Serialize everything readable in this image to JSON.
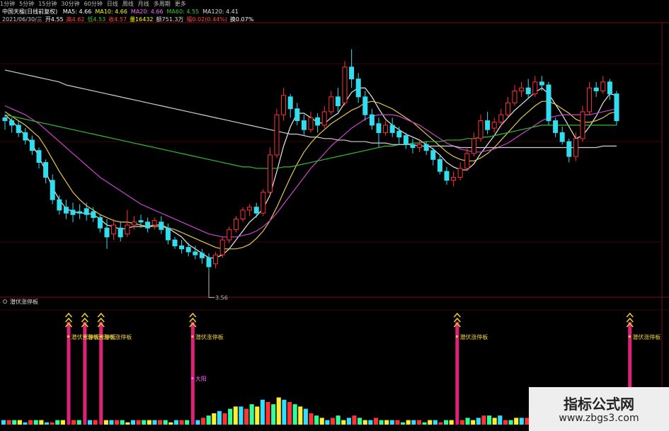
{
  "toolbar": {
    "tabs": [
      "1分钟",
      "5分钟",
      "15分钟",
      "30分钟",
      "60分钟",
      "日线",
      "周线",
      "月线",
      "多周期",
      "更多"
    ]
  },
  "header": {
    "stock": "中国天楹(日线前复权)",
    "ma_items": [
      {
        "label": "MA5: 4.66",
        "color": "#ffffff"
      },
      {
        "label": "MA10: 4.66",
        "color": "#ffff00"
      },
      {
        "label": "MA20: 4.66",
        "color": "#ff66ff"
      },
      {
        "label": "MA60: 4.55",
        "color": "#33cc33"
      },
      {
        "label": "MA120: 4.41",
        "color": "#dddddd"
      }
    ],
    "quote": [
      {
        "text": "2021/06/30/三",
        "color": "#cccccc"
      },
      {
        "text": "开4.55",
        "color": "#ffffff"
      },
      {
        "text": "高4.62",
        "color": "#ff4444"
      },
      {
        "text": "低4.53",
        "color": "#33cc33"
      },
      {
        "text": "收4.57",
        "color": "#ff4444"
      },
      {
        "text": "量16432",
        "color": "#ffff00"
      },
      {
        "text": "额751.3万",
        "color": "#dddddd"
      },
      {
        "text": "幅0.02(0.44%)",
        "color": "#ff4444"
      },
      {
        "text": "换0.07%",
        "color": "#ffffff"
      }
    ]
  },
  "chart_data": [
    {
      "type": "candlestick",
      "title": "中国天楹(日线前复权)",
      "ylim": [
        3.5,
        5.2
      ],
      "min_label": "3.56",
      "candles": [
        [
          4.6,
          4.58,
          4.62,
          4.52
        ],
        [
          4.58,
          4.55,
          4.6,
          4.5
        ],
        [
          4.55,
          4.5,
          4.58,
          4.47
        ],
        [
          4.5,
          4.45,
          4.53,
          4.42
        ],
        [
          4.45,
          4.38,
          4.48,
          4.35
        ],
        [
          4.38,
          4.3,
          4.4,
          4.26
        ],
        [
          4.3,
          4.2,
          4.32,
          4.16
        ],
        [
          4.18,
          4.05,
          4.22,
          4.02
        ],
        [
          4.05,
          3.98,
          4.08,
          3.95
        ],
        [
          4.0,
          3.96,
          4.05,
          3.92
        ],
        [
          3.98,
          3.95,
          4.03,
          3.9
        ],
        [
          3.97,
          3.96,
          4.02,
          3.92
        ],
        [
          3.99,
          3.95,
          4.03,
          3.91
        ],
        [
          3.97,
          3.93,
          4.0,
          3.9
        ],
        [
          3.93,
          3.86,
          3.95,
          3.83
        ],
        [
          3.86,
          3.8,
          3.92,
          3.72
        ],
        [
          3.82,
          3.88,
          3.92,
          3.78
        ],
        [
          3.86,
          3.8,
          3.9,
          3.77
        ],
        [
          3.82,
          3.88,
          3.98,
          3.8
        ],
        [
          3.88,
          3.9,
          3.94,
          3.85
        ],
        [
          3.91,
          3.9,
          3.95,
          3.86
        ],
        [
          3.9,
          3.86,
          3.93,
          3.83
        ],
        [
          3.88,
          3.91,
          3.93,
          3.85
        ],
        [
          3.9,
          3.85,
          3.94,
          3.82
        ],
        [
          3.86,
          3.78,
          3.89,
          3.75
        ],
        [
          3.78,
          3.74,
          3.8,
          3.72
        ],
        [
          3.74,
          3.72,
          3.78,
          3.69
        ],
        [
          3.73,
          3.7,
          3.76,
          3.67
        ],
        [
          3.7,
          3.68,
          3.74,
          3.65
        ],
        [
          3.69,
          3.66,
          3.72,
          3.62
        ],
        [
          3.66,
          3.6,
          3.69,
          3.56
        ],
        [
          3.62,
          3.68,
          3.7,
          3.59
        ],
        [
          3.68,
          3.78,
          3.8,
          3.66
        ],
        [
          3.78,
          3.85,
          3.87,
          3.76
        ],
        [
          3.85,
          3.92,
          3.94,
          3.83
        ],
        [
          3.92,
          3.98,
          4.0,
          3.9
        ],
        [
          3.98,
          4.0,
          4.02,
          3.94
        ],
        [
          4.0,
          3.96,
          4.03,
          3.93
        ],
        [
          3.96,
          4.1,
          4.12,
          3.94
        ],
        [
          4.1,
          4.35,
          4.4,
          4.08
        ],
        [
          4.35,
          4.62,
          4.66,
          4.33
        ],
        [
          4.62,
          4.75,
          4.8,
          4.58
        ],
        [
          4.74,
          4.66,
          4.76,
          4.6
        ],
        [
          4.66,
          4.58,
          4.7,
          4.55
        ],
        [
          4.58,
          4.52,
          4.62,
          4.48
        ],
        [
          4.52,
          4.6,
          4.64,
          4.5
        ],
        [
          4.6,
          4.55,
          4.63,
          4.5
        ],
        [
          4.55,
          4.64,
          4.68,
          4.53
        ],
        [
          4.64,
          4.74,
          4.78,
          4.62
        ],
        [
          4.74,
          4.68,
          4.8,
          4.64
        ],
        [
          4.7,
          4.94,
          4.98,
          4.68
        ],
        [
          4.94,
          4.86,
          5.06,
          4.8
        ],
        [
          4.86,
          4.74,
          4.9,
          4.7
        ],
        [
          4.74,
          4.62,
          4.78,
          4.58
        ],
        [
          4.62,
          4.55,
          4.66,
          4.52
        ],
        [
          4.56,
          4.5,
          4.6,
          4.4
        ],
        [
          4.5,
          4.55,
          4.58,
          4.48
        ],
        [
          4.55,
          4.5,
          4.6,
          4.47
        ],
        [
          4.51,
          4.47,
          4.54,
          4.42
        ],
        [
          4.48,
          4.42,
          4.5,
          4.39
        ],
        [
          4.42,
          4.4,
          4.46,
          4.36
        ],
        [
          4.4,
          4.42,
          4.45,
          4.37
        ],
        [
          4.42,
          4.38,
          4.44,
          4.35
        ],
        [
          4.38,
          4.32,
          4.4,
          4.28
        ],
        [
          4.32,
          4.24,
          4.35,
          4.22
        ],
        [
          4.24,
          4.18,
          4.27,
          4.15
        ],
        [
          4.18,
          4.2,
          4.24,
          4.14
        ],
        [
          4.2,
          4.26,
          4.3,
          4.18
        ],
        [
          4.26,
          4.36,
          4.4,
          4.24
        ],
        [
          4.36,
          4.46,
          4.5,
          4.34
        ],
        [
          4.46,
          4.58,
          4.62,
          4.44
        ],
        [
          4.58,
          4.52,
          4.64,
          4.49
        ],
        [
          4.53,
          4.57,
          4.6,
          4.5
        ],
        [
          4.57,
          4.62,
          4.66,
          4.54
        ],
        [
          4.62,
          4.7,
          4.74,
          4.6
        ],
        [
          4.7,
          4.78,
          4.82,
          4.68
        ],
        [
          4.78,
          4.8,
          4.84,
          4.74
        ],
        [
          4.8,
          4.76,
          4.86,
          4.73
        ],
        [
          4.76,
          4.84,
          4.88,
          4.74
        ],
        [
          4.84,
          4.82,
          4.88,
          4.78
        ],
        [
          4.82,
          4.58,
          4.84,
          4.55
        ],
        [
          4.58,
          4.5,
          4.6,
          4.47
        ],
        [
          4.5,
          4.44,
          4.54,
          4.42
        ],
        [
          4.44,
          4.34,
          4.46,
          4.3
        ],
        [
          4.34,
          4.46,
          4.5,
          4.31
        ],
        [
          4.46,
          4.64,
          4.68,
          4.44
        ],
        [
          4.64,
          4.8,
          4.84,
          4.62
        ],
        [
          4.8,
          4.78,
          4.84,
          4.74
        ],
        [
          4.78,
          4.84,
          4.88,
          4.76
        ],
        [
          4.84,
          4.76,
          4.86,
          4.72
        ],
        [
          4.76,
          4.58,
          4.78,
          4.55
        ]
      ],
      "ma_lines": [
        {
          "name": "MA5",
          "color": "#e8e8e8",
          "values": [
            4.62,
            4.58,
            4.53,
            4.48,
            4.42,
            4.34,
            4.24,
            4.13,
            4.05,
            3.99,
            3.97,
            3.96,
            3.96,
            3.95,
            3.92,
            3.88,
            3.87,
            3.85,
            3.86,
            3.87,
            3.87,
            3.87,
            3.88,
            3.88,
            3.86,
            3.83,
            3.8,
            3.75,
            3.72,
            3.69,
            3.66,
            3.66,
            3.68,
            3.72,
            3.78,
            3.84,
            3.9,
            3.94,
            3.99,
            4.08,
            4.24,
            4.41,
            4.54,
            4.63,
            4.63,
            4.6,
            4.57,
            4.56,
            4.6,
            4.63,
            4.7,
            4.77,
            4.8,
            4.8,
            4.74,
            4.66,
            4.59,
            4.55,
            4.52,
            4.49,
            4.47,
            4.45,
            4.42,
            4.39,
            4.35,
            4.3,
            4.27,
            4.25,
            4.25,
            4.29,
            4.36,
            4.42,
            4.48,
            4.55,
            4.6,
            4.65,
            4.69,
            4.73,
            4.77,
            4.8,
            4.76,
            4.69,
            4.62,
            4.54,
            4.46,
            4.48,
            4.54,
            4.61,
            4.7,
            4.76,
            4.75
          ]
        },
        {
          "name": "MA10",
          "color": "#e6c84a",
          "values": [
            4.64,
            4.61,
            4.58,
            4.55,
            4.51,
            4.47,
            4.4,
            4.32,
            4.24,
            4.17,
            4.1,
            4.05,
            4.01,
            3.98,
            3.95,
            3.93,
            3.91,
            3.9,
            3.9,
            3.89,
            3.88,
            3.87,
            3.87,
            3.87,
            3.86,
            3.85,
            3.83,
            3.81,
            3.79,
            3.77,
            3.75,
            3.73,
            3.72,
            3.72,
            3.72,
            3.73,
            3.75,
            3.79,
            3.84,
            3.91,
            4.0,
            4.1,
            4.2,
            4.29,
            4.37,
            4.43,
            4.48,
            4.52,
            4.56,
            4.59,
            4.62,
            4.65,
            4.67,
            4.7,
            4.71,
            4.7,
            4.68,
            4.66,
            4.63,
            4.6,
            4.57,
            4.53,
            4.49,
            4.45,
            4.41,
            4.37,
            4.34,
            4.32,
            4.31,
            4.31,
            4.33,
            4.36,
            4.4,
            4.45,
            4.5,
            4.55,
            4.6,
            4.64,
            4.68,
            4.71,
            4.71,
            4.69,
            4.66,
            4.63,
            4.59,
            4.57,
            4.57,
            4.58,
            4.6,
            4.63,
            4.64
          ]
        },
        {
          "name": "MA20",
          "color": "#cc44cc",
          "values": [
            4.68,
            4.66,
            4.64,
            4.62,
            4.59,
            4.56,
            4.52,
            4.48,
            4.44,
            4.4,
            4.36,
            4.32,
            4.28,
            4.24,
            4.2,
            4.17,
            4.14,
            4.11,
            4.08,
            4.05,
            4.02,
            4.0,
            3.98,
            3.96,
            3.94,
            3.92,
            3.9,
            3.88,
            3.86,
            3.84,
            3.82,
            3.81,
            3.8,
            3.8,
            3.8,
            3.81,
            3.82,
            3.84,
            3.87,
            3.91,
            3.96,
            4.02,
            4.08,
            4.14,
            4.2,
            4.26,
            4.31,
            4.36,
            4.41,
            4.45,
            4.49,
            4.53,
            4.56,
            4.59,
            4.61,
            4.62,
            4.62,
            4.62,
            4.61,
            4.59,
            4.57,
            4.55,
            4.52,
            4.49,
            4.46,
            4.43,
            4.41,
            4.39,
            4.38,
            4.37,
            4.37,
            4.38,
            4.39,
            4.41,
            4.43,
            4.46,
            4.49,
            4.52,
            4.55,
            4.58,
            4.6,
            4.61,
            4.62,
            4.62,
            4.62,
            4.62,
            4.62,
            4.63,
            4.64,
            4.65,
            4.66
          ]
        },
        {
          "name": "MA60",
          "color": "#33bb33",
          "values": [
            4.62,
            4.61,
            4.6,
            4.59,
            4.58,
            4.57,
            4.56,
            4.55,
            4.54,
            4.53,
            4.52,
            4.51,
            4.5,
            4.49,
            4.48,
            4.47,
            4.46,
            4.45,
            4.44,
            4.43,
            4.42,
            4.41,
            4.4,
            4.39,
            4.38,
            4.37,
            4.36,
            4.35,
            4.34,
            4.33,
            4.32,
            4.31,
            4.3,
            4.29,
            4.28,
            4.27,
            4.27,
            4.26,
            4.26,
            4.26,
            4.26,
            4.27,
            4.27,
            4.28,
            4.29,
            4.3,
            4.31,
            4.32,
            4.33,
            4.34,
            4.35,
            4.36,
            4.37,
            4.38,
            4.39,
            4.4,
            4.41,
            4.41,
            4.42,
            4.42,
            4.43,
            4.43,
            4.44,
            4.44,
            4.44,
            4.45,
            4.45,
            4.45,
            4.46,
            4.46,
            4.47,
            4.47,
            4.48,
            4.49,
            4.5,
            4.51,
            4.52,
            4.53,
            4.54,
            4.55,
            4.55,
            4.55,
            4.55,
            4.55,
            4.55,
            4.55,
            4.55,
            4.55,
            4.55,
            4.55,
            4.55
          ]
        },
        {
          "name": "MA120",
          "color": "#cfcfcf",
          "values": [
            4.92,
            4.91,
            4.9,
            4.89,
            4.88,
            4.87,
            4.86,
            4.85,
            4.84,
            4.82,
            4.81,
            4.8,
            4.79,
            4.78,
            4.77,
            4.76,
            4.75,
            4.74,
            4.73,
            4.72,
            4.71,
            4.7,
            4.69,
            4.68,
            4.67,
            4.66,
            4.65,
            4.64,
            4.63,
            4.62,
            4.61,
            4.6,
            4.59,
            4.58,
            4.57,
            4.56,
            4.55,
            4.54,
            4.53,
            4.52,
            4.51,
            4.5,
            4.49,
            4.49,
            4.48,
            4.47,
            4.47,
            4.46,
            4.46,
            4.45,
            4.45,
            4.44,
            4.44,
            4.44,
            4.43,
            4.43,
            4.43,
            4.42,
            4.42,
            4.42,
            4.42,
            4.41,
            4.41,
            4.41,
            4.41,
            4.41,
            4.41,
            4.4,
            4.4,
            4.4,
            4.4,
            4.4,
            4.4,
            4.4,
            4.4,
            4.4,
            4.4,
            4.4,
            4.4,
            4.4,
            4.4,
            4.4,
            4.4,
            4.4,
            4.4,
            4.4,
            4.4,
            4.4,
            4.41,
            4.41,
            4.41
          ]
        }
      ]
    },
    {
      "type": "bar",
      "title": "潜伏涨停板",
      "signal_label": "潜伏涨停板",
      "other_label": "大阳",
      "signal_indices": [
        12,
        15,
        18,
        35,
        84,
        116
      ],
      "label_index": 35,
      "values": [
        2,
        2,
        2,
        2,
        1,
        2,
        2,
        2,
        1,
        1,
        2,
        2,
        9,
        2,
        2,
        9,
        2,
        2,
        9,
        2,
        2,
        2,
        2,
        1,
        2,
        2,
        2,
        2,
        2,
        2,
        2,
        1,
        2,
        2,
        2,
        9,
        2,
        3,
        4,
        5,
        6,
        5,
        7,
        8,
        8,
        7,
        9,
        8,
        11,
        10,
        9,
        12,
        11,
        10,
        9,
        8,
        7,
        5,
        4,
        3,
        2,
        3,
        4,
        2,
        3,
        4,
        3,
        2,
        2,
        3,
        2,
        2,
        2,
        2,
        1,
        2,
        2,
        2,
        1,
        2,
        2,
        1,
        2,
        2,
        9,
        2,
        3,
        2,
        3,
        4,
        4,
        3,
        4,
        2,
        2,
        3,
        3,
        3,
        2,
        2,
        2,
        3,
        2,
        2,
        2,
        3,
        2,
        2,
        3,
        4,
        3,
        3,
        2,
        2,
        2,
        2,
        9,
        2,
        3,
        2,
        2,
        2
      ],
      "colors_cycle": [
        "#33ddff",
        "#ff3333",
        "#33ff99",
        "#ffee33"
      ]
    }
  ],
  "watermark": {
    "line1": "指标公式网",
    "line2": "www.zbgs3.com"
  }
}
